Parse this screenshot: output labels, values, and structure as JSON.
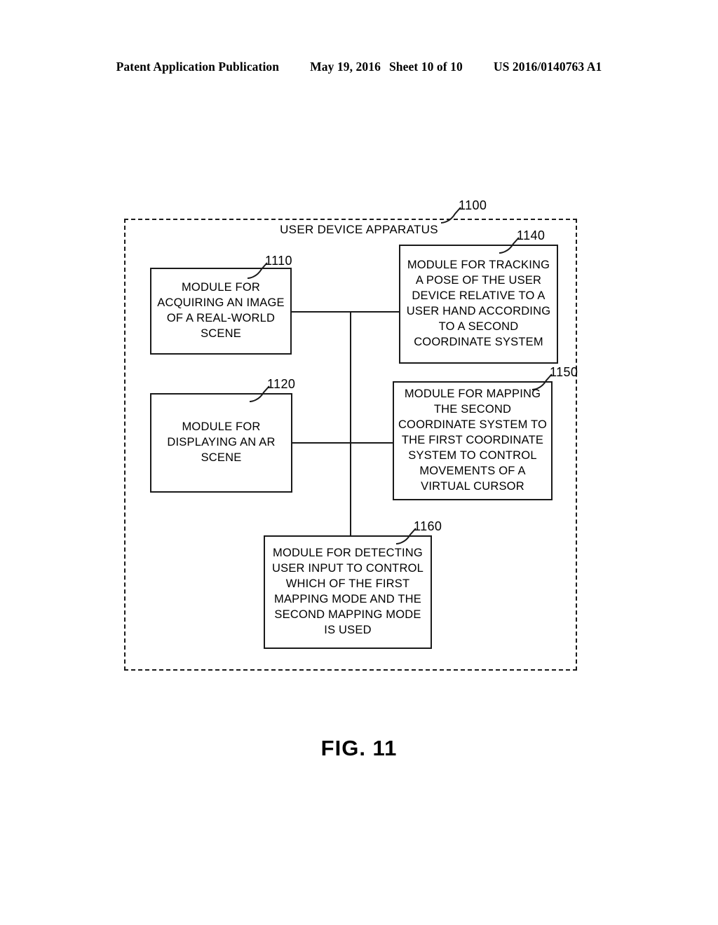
{
  "header": {
    "publication": "Patent Application Publication",
    "date": "May 19, 2016",
    "sheet": "Sheet 10 of 10",
    "patent_number": "US 2016/0140763 A1"
  },
  "figure": {
    "caption": "FIG. 11",
    "container": {
      "ref": "1100",
      "title": "USER DEVICE APPARATUS"
    },
    "modules": [
      {
        "ref": "1110",
        "text": "MODULE FOR ACQUIRING AN IMAGE OF A REAL-WORLD SCENE"
      },
      {
        "ref": "1140",
        "text": "MODULE FOR TRACKING A POSE OF THE USER DEVICE RELATIVE TO A USER HAND ACCORDING TO A SECOND COORDINATE SYSTEM"
      },
      {
        "ref": "1120",
        "text": "MODULE FOR DISPLAYING AN AR SCENE"
      },
      {
        "ref": "1150",
        "text": "MODULE FOR MAPPING THE SECOND COORDINATE SYSTEM TO THE FIRST COORDINATE SYSTEM TO CONTROL MOVEMENTS OF A VIRTUAL CURSOR"
      },
      {
        "ref": "1160",
        "text": "MODULE FOR DETECTING USER INPUT TO CONTROL WHICH OF THE FIRST MAPPING MODE AND THE SECOND MAPPING MODE IS USED"
      }
    ]
  }
}
